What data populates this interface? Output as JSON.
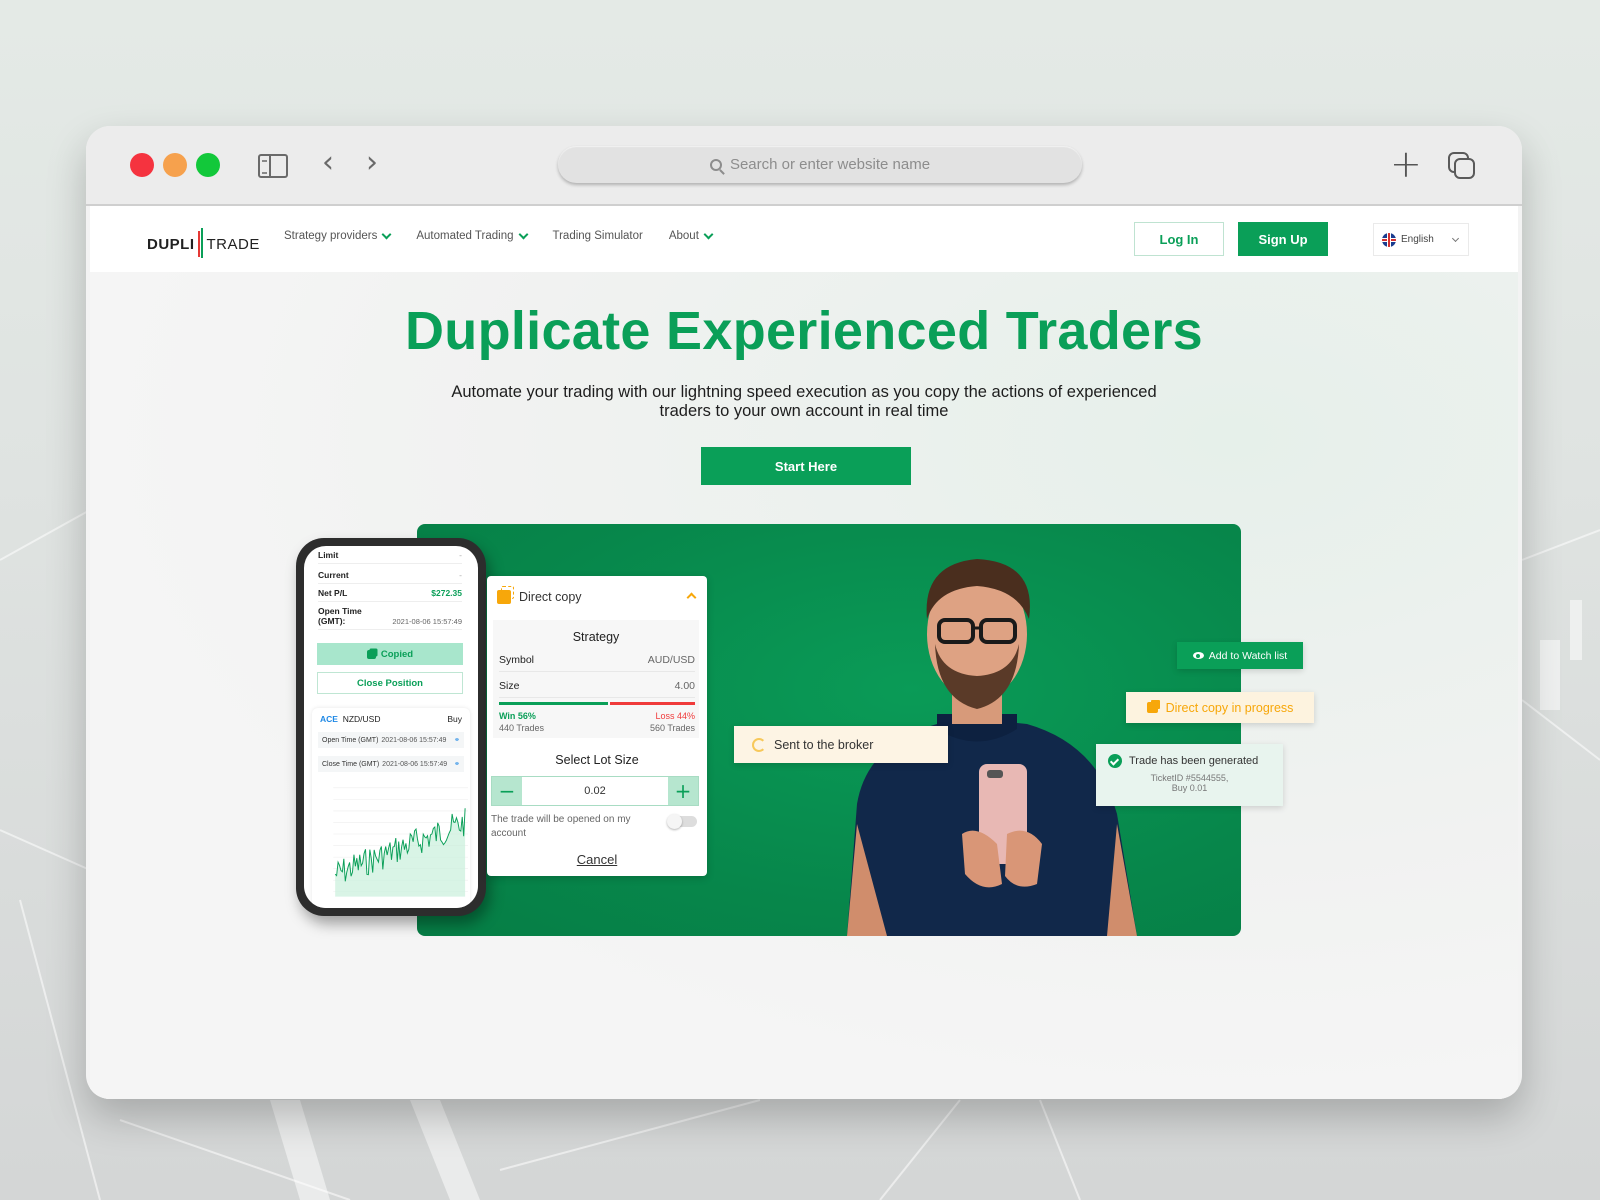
{
  "browser": {
    "url_placeholder": "Search or enter website name",
    "icons": [
      "close-dot",
      "minimize-dot",
      "maximize-dot",
      "sidebar-icon",
      "chevron-left-icon",
      "chevron-right-icon",
      "search-icon",
      "plus-icon",
      "tabs-icon"
    ]
  },
  "nav": {
    "logo_left": "DUPLI",
    "logo_right": "TRADE",
    "menu": [
      {
        "label": "Strategy providers",
        "dropdown": true
      },
      {
        "label": "Automated Trading",
        "dropdown": true
      },
      {
        "label": "Trading Simulator",
        "dropdown": false
      },
      {
        "label": "About",
        "dropdown": true
      }
    ],
    "login_label": "Log In",
    "signup_label": "Sign Up",
    "language": "English"
  },
  "hero": {
    "title": "Duplicate Experienced Traders",
    "subtitle": "Automate your trading with our lightning speed execution as you copy the actions of experienced traders to your own account in real time",
    "cta_label": "Start Here"
  },
  "phone": {
    "rows": [
      {
        "label": "Limit",
        "value": "-"
      },
      {
        "label": "Current",
        "value": "-"
      },
      {
        "label": "Net P/L",
        "value": "$272.35"
      },
      {
        "label": "Open Time (GMT):",
        "value": "2021-08-06 15:57:49"
      }
    ],
    "copied_label": "Copied",
    "close_label": "Close Position",
    "trade": {
      "strategy": "ACE",
      "symbol": "NZD/USD",
      "side": "Buy",
      "open_label": "Open Time (GMT)",
      "open_time": "2021-08-06 15:57:49",
      "close_label": "Close Time (GMT)",
      "close_time": "2021-08-06 15:57:49"
    },
    "accent": "#0a9f58"
  },
  "direct_copy": {
    "title": "Direct copy",
    "strategy_title": "Strategy",
    "symbol_label": "Symbol",
    "symbol_value": "AUD/USD",
    "size_label": "Size",
    "size_value": "4.00",
    "win_label": "Win 56%",
    "win_trades": "440 Trades",
    "win_pct": 56,
    "loss_label": "Loss 44%",
    "loss_trades": "560 Trades",
    "loss_pct": 44,
    "lot_title": "Select Lot Size",
    "lot_value": "0.02",
    "note": "The trade will be opened on my account",
    "toggle_on": false,
    "cancel_label": "Cancel"
  },
  "toasts": {
    "broker": "Sent to the broker",
    "watch": "Add to Watch list",
    "progress": "Direct copy in progress",
    "trade_title": "Trade has been generated",
    "trade_ticket": "TicketID #5544555,",
    "trade_buy": "Buy 0.01"
  },
  "colors": {
    "brand_green": "#0a9f58",
    "loss_red": "#f03b3b",
    "warning_orange": "#f7a70a"
  }
}
